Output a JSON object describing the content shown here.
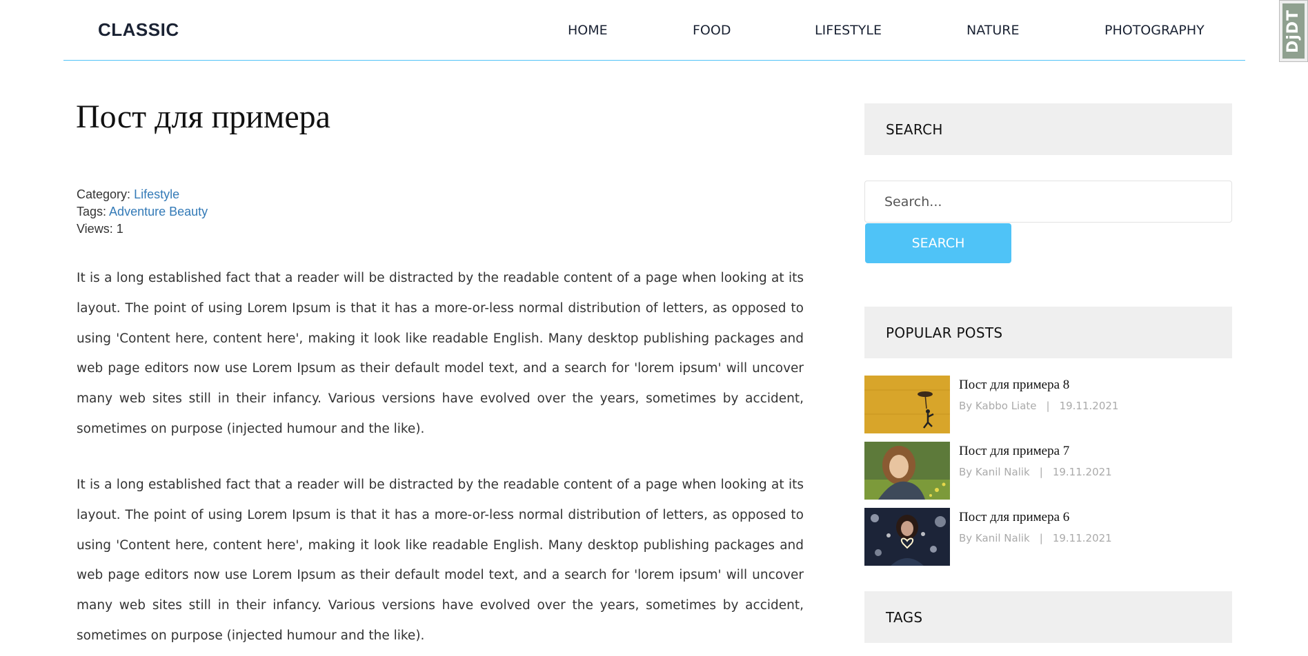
{
  "header": {
    "logo": "CLASSIC",
    "nav": [
      "HOME",
      "FOOD",
      "LIFESTYLE",
      "NATURE",
      "PHOTOGRAPHY"
    ]
  },
  "debug_toolbar": {
    "label": "DjDT"
  },
  "post": {
    "title": "Пост для примера",
    "category_label": "Category:",
    "category": "Lifestyle",
    "tags_label": "Tags:",
    "tags": "Adventure Beauty",
    "views": "Views: 1",
    "paragraphs": [
      "It is a long established fact that a reader will be distracted by the readable content of a page when looking at its layout. The point of using Lorem Ipsum is that it has a more-or-less normal distribution of letters, as opposed to using 'Content here, content here', making it look like readable English. Many desktop publishing packages and web page editors now use Lorem Ipsum as their default model text, and a search for 'lorem ipsum' will uncover many web sites still in their infancy. Various versions have evolved over the years, sometimes by accident, sometimes on purpose (injected humour and the like).",
      "It is a long established fact that a reader will be distracted by the readable content of a page when looking at its layout. The point of using Lorem Ipsum is that it has a more-or-less normal distribution of letters, as opposed to using 'Content here, content here', making it look like readable English. Many desktop publishing packages and web page editors now use Lorem Ipsum as their default model text, and a search for 'lorem ipsum' will uncover many web sites still in their infancy. Various versions have evolved over the years, sometimes by accident, sometimes on purpose (injected humour and the like)."
    ]
  },
  "sidebar": {
    "search_heading": "SEARCH",
    "search_placeholder": "Search...",
    "search_button": "SEARCH",
    "popular_heading": "POPULAR POSTS",
    "popular_posts": [
      {
        "title": "Пост для примера 8",
        "author": "By Kabbo Liate",
        "date": "19.11.2021"
      },
      {
        "title": "Пост для примера 7",
        "author": "By Kanil Nalik",
        "date": "19.11.2021"
      },
      {
        "title": "Пост для примера 6",
        "author": "By Kanil Nalik",
        "date": "19.11.2021"
      }
    ],
    "tags_heading": "TAGS"
  }
}
